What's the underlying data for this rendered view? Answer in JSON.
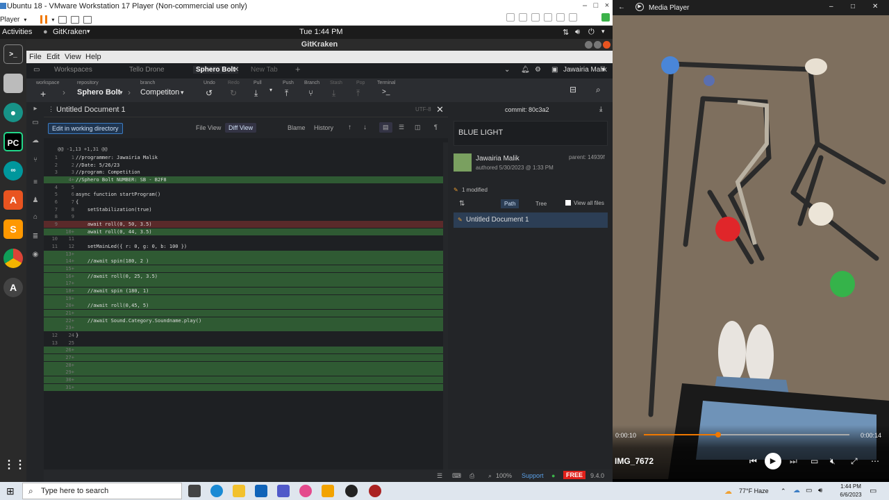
{
  "vmware": {
    "title": "Ubuntu 18 - VMware Workstation 17 Player (Non-commercial use only)",
    "player_label": "Player",
    "window_controls": [
      "–",
      "□",
      "×"
    ]
  },
  "ubuntu": {
    "activities": "Activities",
    "app_name": "GitKraken",
    "clock": "Tue  1:44 PM"
  },
  "gitkraken": {
    "window_title": "GitKraken",
    "menu": [
      "File",
      "Edit",
      "View",
      "Help"
    ],
    "tabs": [
      "Workspaces",
      "Tello Drone",
      "Sphero Bolt",
      "New Tab"
    ],
    "active_tab": "Sphero Bolt",
    "user": "Jawairia Malik",
    "toolbar": {
      "workspace_label": "workspace",
      "repository_label": "repository",
      "repository": "Sphero Bolt",
      "branch_label": "branch",
      "branch": "Competiton",
      "undo": "Undo",
      "redo": "Redo",
      "pull": "Pull",
      "push": "Push",
      "branch_btn": "Branch",
      "stash": "Stash",
      "pop": "Pop",
      "terminal": "Terminal"
    }
  },
  "editor": {
    "filename": "Untitled Document 1",
    "encoding": "UTF-8",
    "edit_button": "Edit in working directory",
    "file_view": "File View",
    "diff_view": "Diff View",
    "blame": "Blame",
    "history": "History",
    "hunk_header": "@@ -1,13 +1,31 @@",
    "lines": [
      {
        "a": "1",
        "b": "1",
        "type": "ctx",
        "text": "//programmer: Jawairia Malik"
      },
      {
        "a": "2",
        "b": "2",
        "type": "ctx",
        "text": "//Date: 5/26/23"
      },
      {
        "a": "3",
        "b": "3",
        "type": "ctx",
        "text": "//program: Competition"
      },
      {
        "a": "",
        "b": "4+",
        "type": "add",
        "text": "//Sphero Bolt NUMBER: SB - B2F8"
      },
      {
        "a": "4",
        "b": "5",
        "type": "ctx",
        "text": ""
      },
      {
        "a": "5",
        "b": "6",
        "type": "ctx",
        "text": "async function startProgram()"
      },
      {
        "a": "6",
        "b": "7",
        "type": "ctx",
        "text": "{"
      },
      {
        "a": "7",
        "b": "8",
        "type": "ctx",
        "text": "    setStabilization(true)"
      },
      {
        "a": "8",
        "b": "9",
        "type": "ctx",
        "text": ""
      },
      {
        "a": "9",
        "b": "",
        "type": "del",
        "text": "    await roll(0, 50, 3.5)"
      },
      {
        "a": "",
        "b": "10+",
        "type": "add",
        "text": "    await roll(0, 44, 3.5)"
      },
      {
        "a": "10",
        "b": "11",
        "type": "ctx",
        "text": ""
      },
      {
        "a": "11",
        "b": "12",
        "type": "ctx",
        "text": "    setMainLed({ r: 0, g: 0, b: 100 })"
      },
      {
        "a": "",
        "b": "13+",
        "type": "add",
        "text": ""
      },
      {
        "a": "",
        "b": "14+",
        "type": "add",
        "text": "    //await spin(180, 2 )"
      },
      {
        "a": "",
        "b": "15+",
        "type": "add",
        "text": ""
      },
      {
        "a": "",
        "b": "16+",
        "type": "add",
        "text": "    //await roll(0, 25, 3.5)"
      },
      {
        "a": "",
        "b": "17+",
        "type": "add",
        "text": ""
      },
      {
        "a": "",
        "b": "18+",
        "type": "add",
        "text": "    //await spin (180, 1)"
      },
      {
        "a": "",
        "b": "19+",
        "type": "add",
        "text": ""
      },
      {
        "a": "",
        "b": "20+",
        "type": "add",
        "text": "    //await roll(0,45, 5)"
      },
      {
        "a": "",
        "b": "21+",
        "type": "add",
        "text": ""
      },
      {
        "a": "",
        "b": "22+",
        "type": "add",
        "text": "    //await Sound.Category.Soundname.play()"
      },
      {
        "a": "",
        "b": "23+",
        "type": "add",
        "text": ""
      },
      {
        "a": "12",
        "b": "24",
        "type": "ctx",
        "text": "}"
      },
      {
        "a": "13",
        "b": "25",
        "type": "ctx",
        "text": ""
      },
      {
        "a": "",
        "b": "26+",
        "type": "add",
        "text": ""
      },
      {
        "a": "",
        "b": "27+",
        "type": "add",
        "text": ""
      },
      {
        "a": "",
        "b": "28+",
        "type": "add",
        "text": ""
      },
      {
        "a": "",
        "b": "29+",
        "type": "add",
        "text": ""
      },
      {
        "a": "",
        "b": "30+",
        "type": "add",
        "text": ""
      },
      {
        "a": "",
        "b": "31+",
        "type": "add",
        "text": ""
      }
    ]
  },
  "commit_panel": {
    "commit_label": "commit: 80c3a2",
    "message": "BLUE LIGHT",
    "author": "Jawairia Malik",
    "authored": "authored 5/30/2023 @ 1:33 PM",
    "parent": "parent: 14939f",
    "modified": "1 modified",
    "path": "Path",
    "tree": "Tree",
    "view_all": "View all files",
    "file": "Untitled Document 1"
  },
  "statusbar": {
    "zoom": "100%",
    "support": "Support",
    "free": "FREE",
    "version": "9.4.0"
  },
  "media_player": {
    "title": "Media Player",
    "time_current": "0:00:10",
    "time_total": "0:00:14",
    "progress": 0.36,
    "file_name": "IMG_7672"
  },
  "taskbar": {
    "search_placeholder": "Type here to search",
    "weather": "77°F  Haze",
    "time": "1:44 PM",
    "date": "6/6/2023"
  },
  "colors": {
    "accent_blue": "#3c7dc4",
    "add_green": "#2f5a33",
    "del_red": "#5a2a2a",
    "media_orange": "#f07800"
  }
}
